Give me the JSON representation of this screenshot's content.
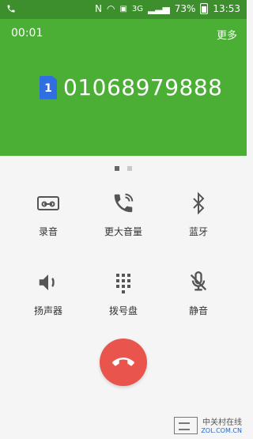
{
  "status_bar": {
    "network": "3G",
    "battery_percent": "73%",
    "time": "13:53"
  },
  "call": {
    "timer": "00:01",
    "more_label": "更多",
    "sim_slot": "1",
    "phone_number": "01068979888"
  },
  "actions": [
    {
      "label": "录音"
    },
    {
      "label": "更大音量"
    },
    {
      "label": "蓝牙"
    },
    {
      "label": "扬声器"
    },
    {
      "label": "拨号盘"
    },
    {
      "label": "静音"
    }
  ],
  "watermark": {
    "cn": "中关村在线",
    "url": "ZOL.COM.CN"
  },
  "colors": {
    "status_bar": "#3c8f2c",
    "header_green": "#4caf35",
    "end_call_red": "#e9544d",
    "icon_gray": "#555555"
  }
}
